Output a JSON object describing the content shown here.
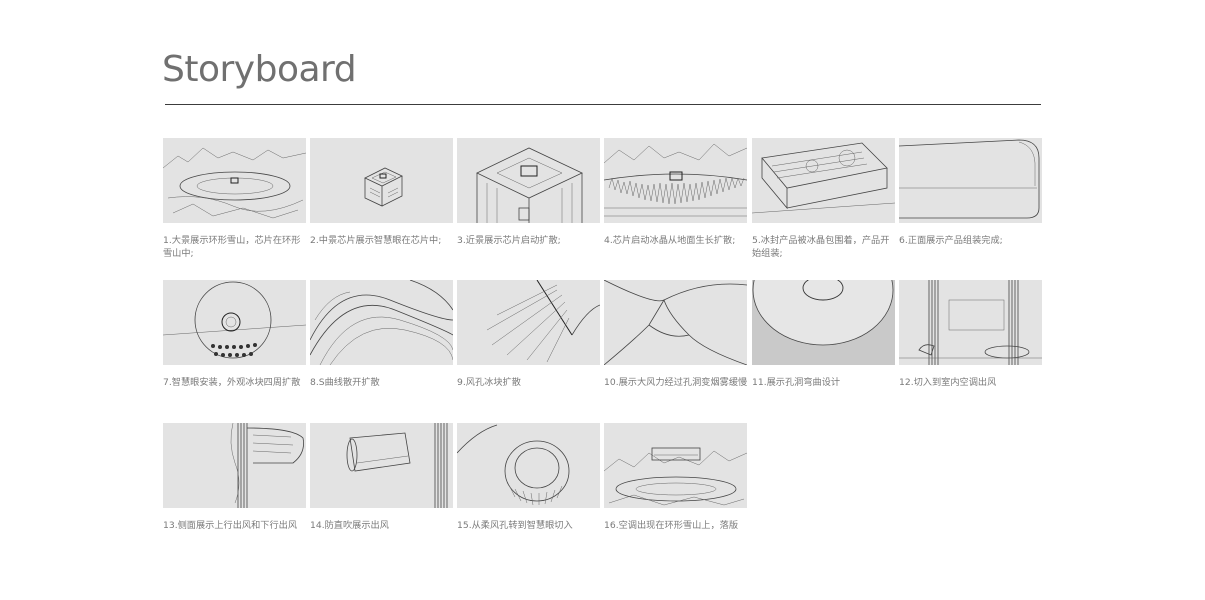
{
  "title": "Storyboard",
  "frames": [
    {
      "caption": "1.大景展示环形雪山，芯片在环形雪山中;"
    },
    {
      "caption": "2.中景芯片展示智慧眼在芯片中;"
    },
    {
      "caption": "3.近景展示芯片启动扩散;"
    },
    {
      "caption": "4.芯片启动冰晶从地面生长扩散;"
    },
    {
      "caption": "5.冰封产品被冰晶包围着，产品开始组装;"
    },
    {
      "caption": "6.正面展示产品组装完成;"
    },
    {
      "caption": "7.智慧眼安装，外观冰块四周扩散"
    },
    {
      "caption": "8.S曲线散开扩散"
    },
    {
      "caption": "9.风孔冰块扩散"
    },
    {
      "caption": "10.展示大风力经过孔洞变烟雾缓慢"
    },
    {
      "caption": "11.展示孔洞弯曲设计"
    },
    {
      "caption": "12.切入到室内空调出风"
    },
    {
      "caption": "13.侧面展示上行出风和下行出风"
    },
    {
      "caption": "14.防直吹展示出风"
    },
    {
      "caption": "15.从柔风孔转到智慧眼切入"
    },
    {
      "caption": "16.空调出现在环形雪山上，落版"
    }
  ]
}
